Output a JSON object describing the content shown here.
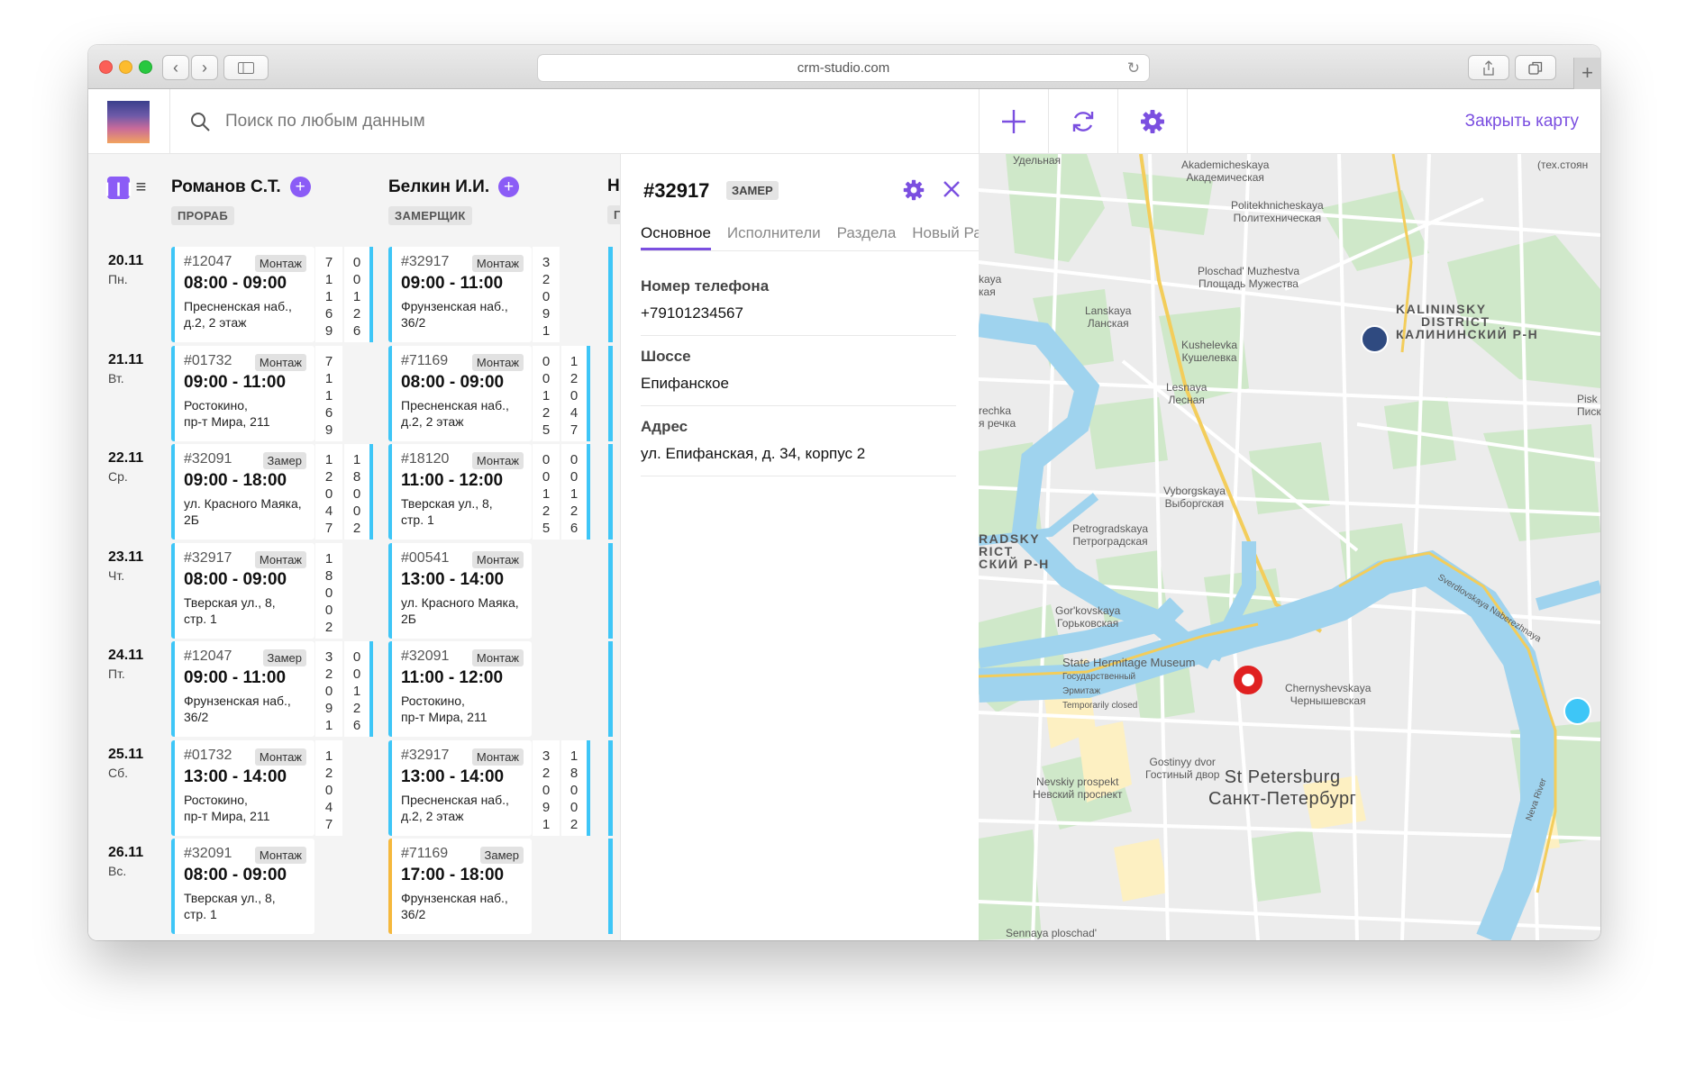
{
  "browser": {
    "url": "crm-studio.com"
  },
  "header": {
    "search_placeholder": "Поиск по любым данным",
    "close_map": "Закрыть карту"
  },
  "schedule": {
    "columns": [
      {
        "name": "Романов С.Т.",
        "role": "ПРОРАБ"
      },
      {
        "name": "Белкин И.И.",
        "role": "ЗАМЕРЩИК"
      },
      {
        "name": "Н",
        "role": "Г"
      }
    ],
    "days": [
      {
        "date": "20.11",
        "weekday": "Пн."
      },
      {
        "date": "21.11",
        "weekday": "Вт."
      },
      {
        "date": "22.11",
        "weekday": "Ср."
      },
      {
        "date": "23.11",
        "weekday": "Чт."
      },
      {
        "date": "24.11",
        "weekday": "Пт."
      },
      {
        "date": "25.11",
        "weekday": "Сб."
      },
      {
        "date": "26.11",
        "weekday": "Вс."
      }
    ],
    "cards": {
      "c1": [
        {
          "num": "#12047",
          "badge": "Монтаж",
          "time": "08:00 - 09:00",
          "addr1": "Пресненская наб.,",
          "addr2": "д.2, 2 этаж",
          "v1": "71169",
          "v2": "00126"
        },
        {
          "num": "#01732",
          "badge": "Монтаж",
          "time": "09:00 - 11:00",
          "addr1": "Ростокино,",
          "addr2": "пр-т Мира, 211",
          "v1": "71169",
          "v2": ""
        },
        {
          "num": "#32091",
          "badge": "Замер",
          "time": "09:00 - 18:00",
          "addr1": "ул. Красного Маяка,",
          "addr2": "2Б",
          "v1": "12047",
          "v2": "18002"
        },
        {
          "num": "#32917",
          "badge": "Монтаж",
          "time": "08:00 - 09:00",
          "addr1": "Тверская ул., 8,",
          "addr2": "стр. 1",
          "v1": "18002",
          "v2": ""
        },
        {
          "num": "#12047",
          "badge": "Замер",
          "time": "09:00 - 11:00",
          "addr1": "Фрунзенская наб.,",
          "addr2": "36/2",
          "v1": "32091",
          "v2": "00126"
        },
        {
          "num": "#01732",
          "badge": "Монтаж",
          "time": "13:00 - 14:00",
          "addr1": "Ростокино,",
          "addr2": "пр-т Мира, 211",
          "v1": "12047",
          "v2": ""
        },
        {
          "num": "#32091",
          "badge": "Монтаж",
          "time": "08:00 - 09:00",
          "addr1": "Тверская ул., 8,",
          "addr2": "стр. 1",
          "v1": "",
          "v2": ""
        }
      ],
      "c2": [
        {
          "num": "#32917",
          "badge": "Монтаж",
          "time": "09:00 - 11:00",
          "addr1": "Фрунзенская наб.,",
          "addr2": "36/2",
          "v1": "32091",
          "v2": ""
        },
        {
          "num": "#71169",
          "badge": "Монтаж",
          "time": "08:00 - 09:00",
          "addr1": "Пресненская наб.,",
          "addr2": "д.2, 2 этаж",
          "v1": "00125",
          "v2": "12047"
        },
        {
          "num": "#18120",
          "badge": "Монтаж",
          "time": "11:00 - 12:00",
          "addr1": "Тверская ул., 8,",
          "addr2": "стр. 1",
          "v1": "00125",
          "v2": "00126"
        },
        {
          "num": "#00541",
          "badge": "Монтаж",
          "time": "13:00 - 14:00",
          "addr1": "ул. Красного Маяка,",
          "addr2": "2Б",
          "v1": "",
          "v2": ""
        },
        {
          "num": "#32091",
          "badge": "Монтаж",
          "time": "11:00 - 12:00",
          "addr1": "Ростокино,",
          "addr2": "пр-т Мира, 211",
          "v1": "",
          "v2": ""
        },
        {
          "num": "#32917",
          "badge": "Монтаж",
          "time": "13:00 - 14:00",
          "addr1": "Пресненская наб.,",
          "addr2": "д.2, 2 этаж",
          "v1": "32091",
          "v2": "18002"
        },
        {
          "num": "#71169",
          "badge": "Замер",
          "time": "17:00 - 18:00",
          "addr1": "Фрунзенская наб.,",
          "addr2": "36/2",
          "v1": "",
          "v2": ""
        }
      ]
    }
  },
  "detail": {
    "id": "#32917",
    "type": "ЗАМЕР",
    "tabs": [
      "Основное",
      "Исполнители",
      "Раздела",
      "Новый Ра"
    ],
    "fields": [
      {
        "label": "Номер телефона",
        "value": "+79101234567"
      },
      {
        "label": "Шоссе",
        "value": "Епифанское"
      },
      {
        "label": "Адрес",
        "value": "ул. Епифанская, д. 34, корпус 2"
      }
    ]
  },
  "map": {
    "labels": {
      "udelnaya": "Удельная",
      "akadem_en": "Akademicheskaya",
      "akadem_ru": "Академическая",
      "tech": "(тех.стоян",
      "poly_en": "Politekhnicheskaya",
      "poly_ru": "Политехническая",
      "plosch_en": "Ploschad' Muzhestva",
      "plosch_ru": "Площадь Мужества",
      "kal_en": "KALININSKY",
      "kal_en2": "DISTRICT",
      "kal_ru": "КАЛИНИНСКИЙ Р-Н",
      "lansk_en": "Lanskaya",
      "lansk_ru": "Ланская",
      "kush_en": "Kushelevka",
      "kush_ru": "Кушелевка",
      "lesn_en": "Lesnaya",
      "lesn_ru": "Лесная",
      "vyb_en": "Vyborgskaya",
      "vyb_ru": "Выборгская",
      "petro_en": "Petrogradskaya",
      "petro_ru": "Петроградская",
      "rds1": "RADSKY",
      "rds2": "RICT",
      "rds3": "СКИЙ Р-Н",
      "gork_en": "Gor'kovskaya",
      "gork_ru": "Горьковская",
      "herm_en": "State Hermitage Museum",
      "herm_ru1": "Государственный",
      "herm_ru2": "Эрмитаж",
      "herm_closed": "Temporarily closed",
      "cher_en": "Chernyshevskaya",
      "cher_ru": "Чернышевская",
      "gost_en": "Gostinyy dvor",
      "gost_ru": "Гостиный двор",
      "nev_en": "Nevskiy prospekt",
      "nev_ru": "Невский проспект",
      "spb_en": "St Petersburg",
      "spb_ru": "Санкт-Петербург",
      "senn": "Sennaya ploschad'",
      "sverd": "Sverdlovskaya Naberezhnaya",
      "neva": "Neva River",
      "rechka": "rechka",
      "rechka_ru": "я речка",
      "piska": "Pisk",
      "piska_ru": "Писк",
      "kaya": "kaya",
      "kaya_ru": "кая"
    },
    "pins": [
      {
        "name": "blue-dark",
        "color": "#2f4a80"
      },
      {
        "name": "red",
        "color": "#e02020"
      },
      {
        "name": "light-blue",
        "color": "#3ec6f7"
      }
    ]
  },
  "colors": {
    "accent": "#7b4fe0",
    "card_blue": "#3ec6f7",
    "card_yellow": "#f5b83d"
  }
}
